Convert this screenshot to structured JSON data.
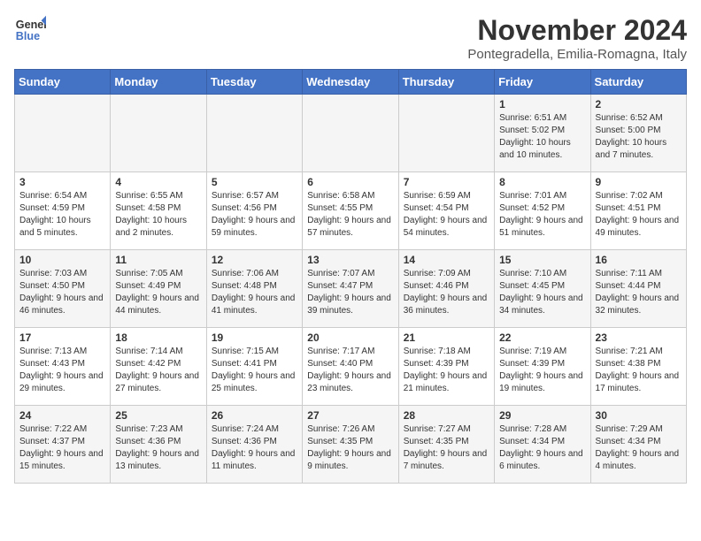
{
  "logo": {
    "line1": "General",
    "line2": "Blue"
  },
  "title": "November 2024",
  "location": "Pontegradella, Emilia-Romagna, Italy",
  "days_of_week": [
    "Sunday",
    "Monday",
    "Tuesday",
    "Wednesday",
    "Thursday",
    "Friday",
    "Saturday"
  ],
  "weeks": [
    [
      {
        "day": "",
        "info": ""
      },
      {
        "day": "",
        "info": ""
      },
      {
        "day": "",
        "info": ""
      },
      {
        "day": "",
        "info": ""
      },
      {
        "day": "",
        "info": ""
      },
      {
        "day": "1",
        "info": "Sunrise: 6:51 AM\nSunset: 5:02 PM\nDaylight: 10 hours and 10 minutes."
      },
      {
        "day": "2",
        "info": "Sunrise: 6:52 AM\nSunset: 5:00 PM\nDaylight: 10 hours and 7 minutes."
      }
    ],
    [
      {
        "day": "3",
        "info": "Sunrise: 6:54 AM\nSunset: 4:59 PM\nDaylight: 10 hours and 5 minutes."
      },
      {
        "day": "4",
        "info": "Sunrise: 6:55 AM\nSunset: 4:58 PM\nDaylight: 10 hours and 2 minutes."
      },
      {
        "day": "5",
        "info": "Sunrise: 6:57 AM\nSunset: 4:56 PM\nDaylight: 9 hours and 59 minutes."
      },
      {
        "day": "6",
        "info": "Sunrise: 6:58 AM\nSunset: 4:55 PM\nDaylight: 9 hours and 57 minutes."
      },
      {
        "day": "7",
        "info": "Sunrise: 6:59 AM\nSunset: 4:54 PM\nDaylight: 9 hours and 54 minutes."
      },
      {
        "day": "8",
        "info": "Sunrise: 7:01 AM\nSunset: 4:52 PM\nDaylight: 9 hours and 51 minutes."
      },
      {
        "day": "9",
        "info": "Sunrise: 7:02 AM\nSunset: 4:51 PM\nDaylight: 9 hours and 49 minutes."
      }
    ],
    [
      {
        "day": "10",
        "info": "Sunrise: 7:03 AM\nSunset: 4:50 PM\nDaylight: 9 hours and 46 minutes."
      },
      {
        "day": "11",
        "info": "Sunrise: 7:05 AM\nSunset: 4:49 PM\nDaylight: 9 hours and 44 minutes."
      },
      {
        "day": "12",
        "info": "Sunrise: 7:06 AM\nSunset: 4:48 PM\nDaylight: 9 hours and 41 minutes."
      },
      {
        "day": "13",
        "info": "Sunrise: 7:07 AM\nSunset: 4:47 PM\nDaylight: 9 hours and 39 minutes."
      },
      {
        "day": "14",
        "info": "Sunrise: 7:09 AM\nSunset: 4:46 PM\nDaylight: 9 hours and 36 minutes."
      },
      {
        "day": "15",
        "info": "Sunrise: 7:10 AM\nSunset: 4:45 PM\nDaylight: 9 hours and 34 minutes."
      },
      {
        "day": "16",
        "info": "Sunrise: 7:11 AM\nSunset: 4:44 PM\nDaylight: 9 hours and 32 minutes."
      }
    ],
    [
      {
        "day": "17",
        "info": "Sunrise: 7:13 AM\nSunset: 4:43 PM\nDaylight: 9 hours and 29 minutes."
      },
      {
        "day": "18",
        "info": "Sunrise: 7:14 AM\nSunset: 4:42 PM\nDaylight: 9 hours and 27 minutes."
      },
      {
        "day": "19",
        "info": "Sunrise: 7:15 AM\nSunset: 4:41 PM\nDaylight: 9 hours and 25 minutes."
      },
      {
        "day": "20",
        "info": "Sunrise: 7:17 AM\nSunset: 4:40 PM\nDaylight: 9 hours and 23 minutes."
      },
      {
        "day": "21",
        "info": "Sunrise: 7:18 AM\nSunset: 4:39 PM\nDaylight: 9 hours and 21 minutes."
      },
      {
        "day": "22",
        "info": "Sunrise: 7:19 AM\nSunset: 4:39 PM\nDaylight: 9 hours and 19 minutes."
      },
      {
        "day": "23",
        "info": "Sunrise: 7:21 AM\nSunset: 4:38 PM\nDaylight: 9 hours and 17 minutes."
      }
    ],
    [
      {
        "day": "24",
        "info": "Sunrise: 7:22 AM\nSunset: 4:37 PM\nDaylight: 9 hours and 15 minutes."
      },
      {
        "day": "25",
        "info": "Sunrise: 7:23 AM\nSunset: 4:36 PM\nDaylight: 9 hours and 13 minutes."
      },
      {
        "day": "26",
        "info": "Sunrise: 7:24 AM\nSunset: 4:36 PM\nDaylight: 9 hours and 11 minutes."
      },
      {
        "day": "27",
        "info": "Sunrise: 7:26 AM\nSunset: 4:35 PM\nDaylight: 9 hours and 9 minutes."
      },
      {
        "day": "28",
        "info": "Sunrise: 7:27 AM\nSunset: 4:35 PM\nDaylight: 9 hours and 7 minutes."
      },
      {
        "day": "29",
        "info": "Sunrise: 7:28 AM\nSunset: 4:34 PM\nDaylight: 9 hours and 6 minutes."
      },
      {
        "day": "30",
        "info": "Sunrise: 7:29 AM\nSunset: 4:34 PM\nDaylight: 9 hours and 4 minutes."
      }
    ]
  ]
}
